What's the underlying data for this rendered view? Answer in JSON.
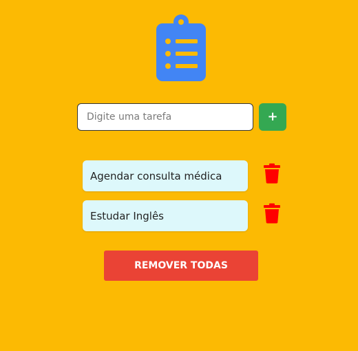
{
  "header": {
    "logo_icon": "clipboard-list-icon",
    "logo_color": "#4285F4"
  },
  "add_form": {
    "input_value": "",
    "placeholder": "Digite uma tarefa",
    "add_label": "+",
    "add_color": "#34A852"
  },
  "tasks": [
    {
      "text": "Agendar consulta médica",
      "delete_icon": "trash-icon"
    },
    {
      "text": "Estudar Inglês",
      "delete_icon": "trash-icon"
    }
  ],
  "remove_all": {
    "label": "REMOVER TODAS",
    "color": "#EA4335"
  },
  "colors": {
    "background": "#FCBA03",
    "task_background": "#DDF8FB",
    "delete_icon": "#FF0000"
  }
}
